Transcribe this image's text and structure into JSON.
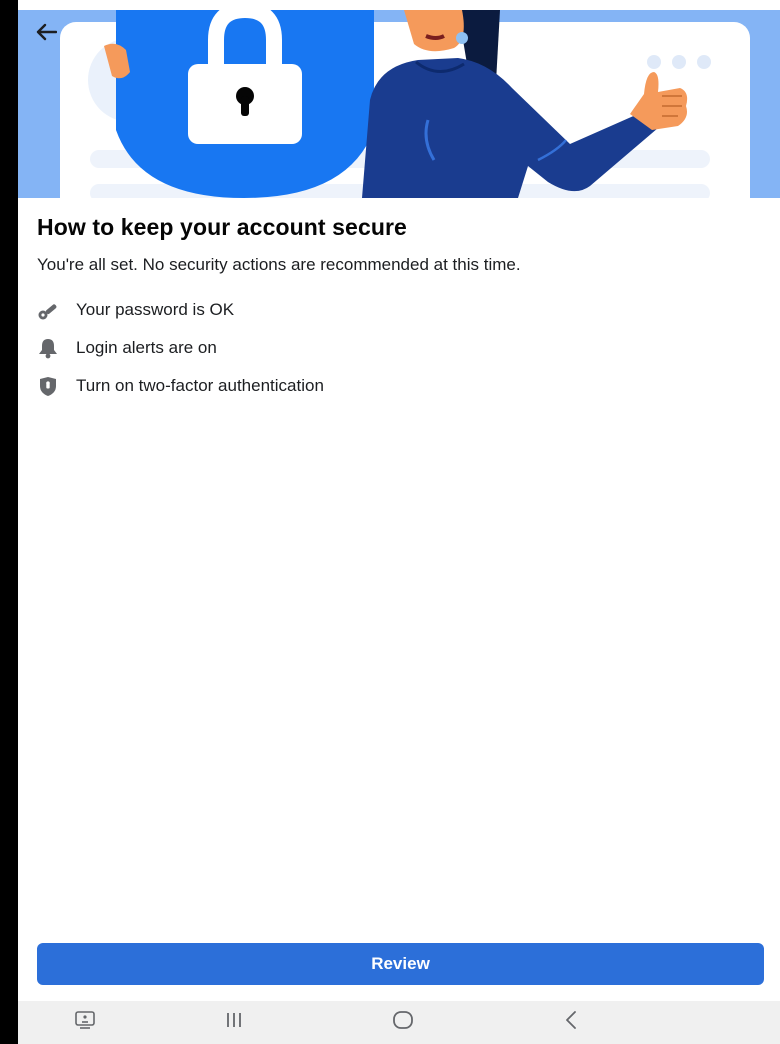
{
  "header": {
    "back_icon": "arrow-left-icon",
    "illustration": "security-lock-shield-illustration"
  },
  "main": {
    "title": "How to keep your account secure",
    "subtitle": "You're all set. No security actions are recommended at this time.",
    "items": [
      {
        "icon": "key-icon",
        "label": "Your password is OK"
      },
      {
        "icon": "bell-icon",
        "label": "Login alerts are on"
      },
      {
        "icon": "shield-lock-icon",
        "label": "Turn on two-factor authentication"
      }
    ]
  },
  "footer": {
    "review_label": "Review"
  },
  "navbar": {
    "buttons": [
      "recent-apps-alt-icon",
      "recents-icon",
      "home-icon",
      "back-icon"
    ]
  },
  "colors": {
    "accent": "#2c6fd9",
    "hero_bg": "#84b4f5",
    "shield": "#1877f2",
    "sweater": "#1a3c8f",
    "icon_grey": "#65676b"
  }
}
